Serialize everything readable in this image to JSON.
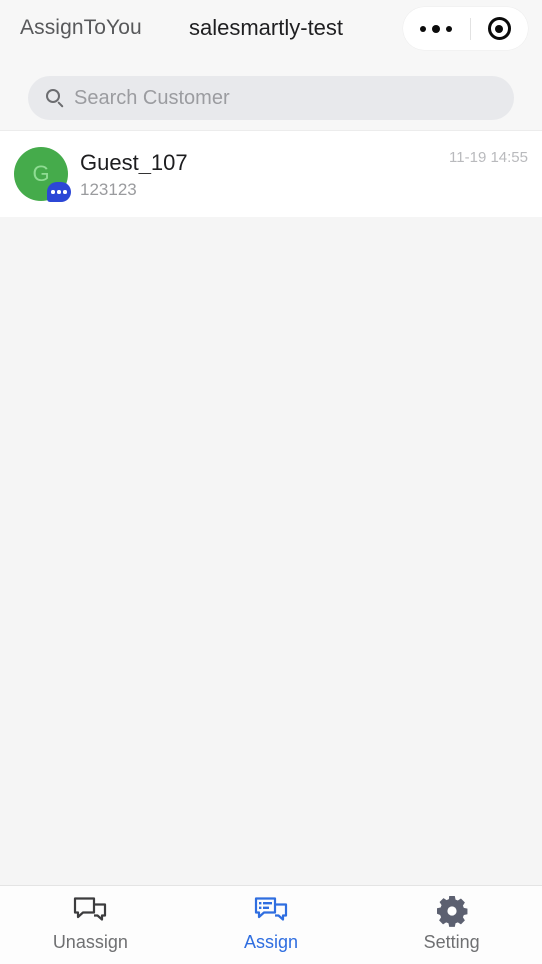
{
  "header": {
    "app_name": "AssignToYou",
    "title": "salesmartly-test",
    "capsule": {
      "more_icon": "more-dots-icon",
      "target_icon": "target-circle-icon"
    }
  },
  "search": {
    "icon": "search-icon",
    "placeholder": "Search Customer",
    "value": ""
  },
  "conversations": [
    {
      "avatar_letter": "G",
      "avatar_color": "#45ab4b",
      "badge_icon": "chat-bubble-badge-icon",
      "badge_color": "#2c47d6",
      "name": "Guest_107",
      "preview": "123123",
      "time": "11-19 14:55"
    }
  ],
  "tabbar": {
    "active_color": "#2f6ee0",
    "inactive_color": "#6f7072",
    "tabs": [
      {
        "label": "Unassign",
        "icon": "chat-bubbles-outline-icon",
        "active": false
      },
      {
        "label": "Assign",
        "icon": "chat-bubbles-list-icon",
        "active": true
      },
      {
        "label": "Setting",
        "icon": "gear-icon",
        "active": false
      }
    ]
  }
}
